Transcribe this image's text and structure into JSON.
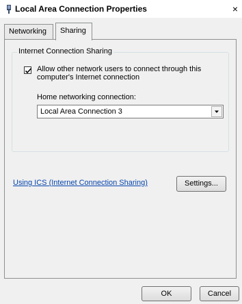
{
  "window": {
    "title": "Local Area Connection Properties",
    "close_glyph": "×"
  },
  "tabs": [
    {
      "label": "Networking",
      "selected": false
    },
    {
      "label": "Sharing",
      "selected": true
    }
  ],
  "sharing": {
    "group_title": "Internet Connection Sharing",
    "allow_checkbox": {
      "label": "Allow other network users to connect through this computer's Internet connection",
      "checked": true
    },
    "home_networking": {
      "label": "Home networking connection:",
      "selected_value": "Local Area Connection 3"
    },
    "ics_link": "Using ICS (Internet Connection Sharing)",
    "settings_button": "Settings..."
  },
  "footer": {
    "ok_label": "OK",
    "cancel_label": "Cancel"
  },
  "colors": {
    "link": "#0645ad",
    "dialog_background": "#f0f0f0"
  }
}
